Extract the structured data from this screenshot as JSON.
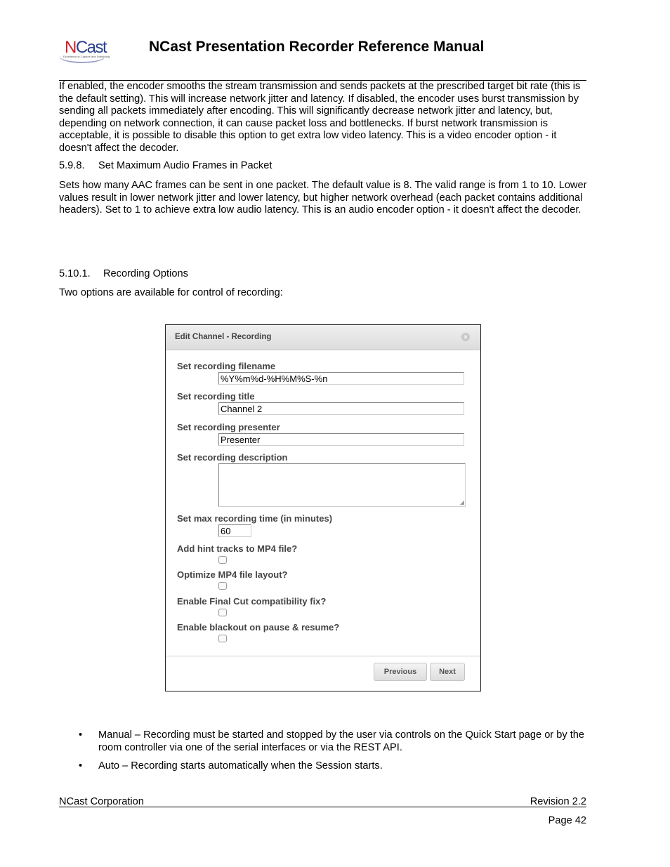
{
  "header": {
    "logo_text_n": "N",
    "logo_text_rest": "Cast",
    "logo_tagline": "Excellence in Capture and Streaming",
    "title": "NCast Presentation Recorder Reference Manual"
  },
  "body": {
    "para1": "If enabled, the encoder smooths the stream transmission and sends packets at the prescribed target bit rate (this is the default setting). This will increase network jitter and latency. If disabled, the encoder uses burst transmission by sending all packets immediately after encoding. This will significantly decrease network jitter and latency, but, depending on network connection, it can cause packet loss and bottlenecks. If burst network transmission is acceptable, it is possible to disable this option to get extra low video latency. This is a video encoder option - it doesn't affect the decoder.",
    "section_598_num": "5.9.8.",
    "section_598_title": "Set Maximum Audio Frames in Packet",
    "para2": "Sets how many AAC frames can be sent in one packet. The default value is 8. The valid range is from 1 to 10. Lower values result in lower network jitter and lower latency, but higher network overhead (each packet contains additional headers). Set to 1 to achieve extra low audio latency. This is an audio encoder option - it doesn't affect the decoder.",
    "section_5101_num": "5.10.1.",
    "section_5101_title": "Recording Options",
    "para3": "Two options are available for control of recording:",
    "bullets": [
      {
        "symbol": "•",
        "text": "Manual – Recording must be started and stopped by the user via controls on the Quick Start page or by the room controller via one of the serial interfaces or via the REST API."
      },
      {
        "symbol": "•",
        "text": "Auto – Recording starts automatically when the Session starts."
      }
    ]
  },
  "dialog": {
    "title": "Edit Channel - Recording",
    "close_icon": "close-circle-icon",
    "fields": {
      "filename_label": "Set recording filename",
      "filename_value": "%Y%m%d-%H%M%S-%n",
      "title_label": "Set recording title",
      "title_value": "Channel 2",
      "presenter_label": "Set recording presenter",
      "presenter_value": "Presenter",
      "description_label": "Set recording description",
      "description_value": "",
      "max_time_label": "Set max recording time (in minutes)",
      "max_time_value": "60",
      "hint_tracks_label": "Add hint tracks to MP4 file?",
      "hint_tracks_checked": false,
      "optimize_label": "Optimize MP4 file layout?",
      "optimize_checked": false,
      "finalcut_label": "Enable Final Cut compatibility fix?",
      "finalcut_checked": false,
      "blackout_label": "Enable blackout on pause & resume?",
      "blackout_checked": false
    },
    "buttons": {
      "previous": "Previous",
      "next": "Next"
    }
  },
  "footer": {
    "company": "NCast Corporation",
    "revision": "Revision 2.2",
    "page": "Page 42"
  }
}
